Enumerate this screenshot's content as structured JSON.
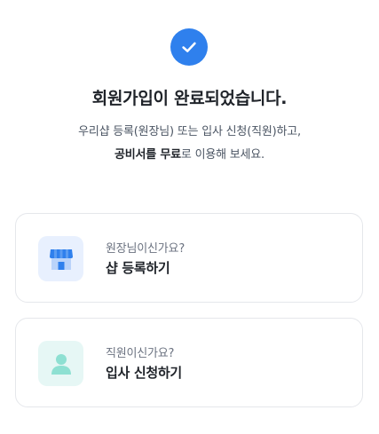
{
  "header": {
    "title": "회원가입이 완료되었습니다.",
    "desc_line1": "우리샵 등록(원장님) 또는 입사 신청(직원)하고,",
    "desc_line2_bold": "공비서를 무료",
    "desc_line2_rest": "로 이용해 보세요."
  },
  "cards": [
    {
      "subtitle": "원장님이신가요?",
      "action": "샵 등록하기",
      "icon": "store-icon"
    },
    {
      "subtitle": "직원이신가요?",
      "action": "입사 신청하기",
      "icon": "person-icon"
    }
  ],
  "colors": {
    "accent": "#2f80ed",
    "store_bg": "#e8f0fe",
    "person_bg": "#e6f7f5",
    "person_icon": "#8ee0d2"
  }
}
